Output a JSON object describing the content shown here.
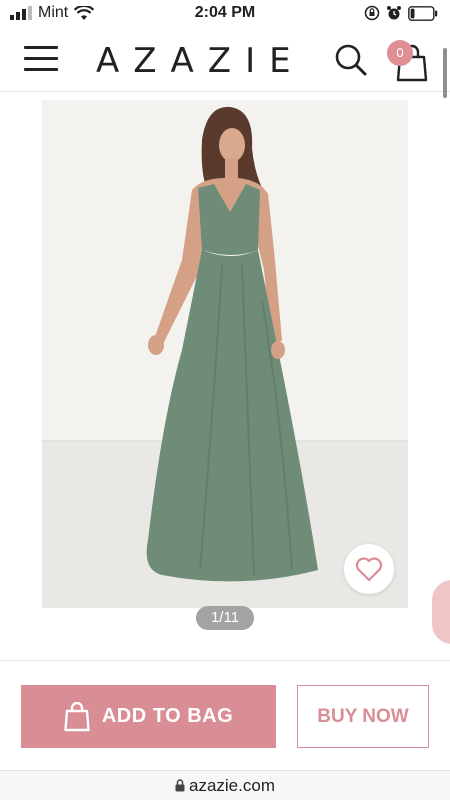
{
  "status_bar": {
    "carrier": "Mint",
    "time": "2:04 PM",
    "battery_level": 0.18
  },
  "header": {
    "logo": "AZAZIE",
    "bag_count": "0"
  },
  "product": {
    "image_pager": "1/11",
    "dress_color": "#6e8c77"
  },
  "actions": {
    "add_to_bag_label": "ADD TO BAG",
    "buy_now_label": "BUY NOW"
  },
  "browser": {
    "url": "azazie.com"
  },
  "colors": {
    "accent": "#d98e95",
    "side_pill": "#efc6c3"
  },
  "icons": {
    "menu": "hamburger-icon",
    "search": "search-icon",
    "bag": "shopping-bag-icon",
    "wishlist": "heart-icon",
    "add_bag": "bag-icon",
    "lock": "lock-icon"
  }
}
